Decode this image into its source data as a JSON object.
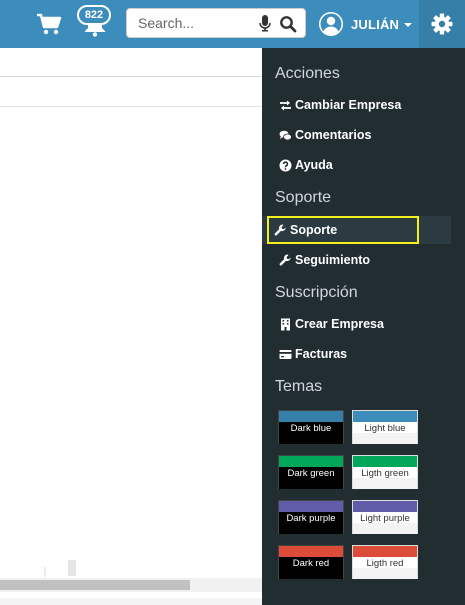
{
  "header": {
    "notifications_count": "822",
    "search_placeholder": "Search...",
    "user_name": "JULIÁN",
    "colors": {
      "bar": "#3c8dbc",
      "bar_dark": "#367fa9"
    }
  },
  "sidebar": {
    "background": "#222d32",
    "sections": {
      "acciones": "Acciones",
      "soporte": "Soporte",
      "suscripcion": "Suscripción",
      "temas": "Temas"
    },
    "items": {
      "cambiar_empresa": "Cambiar Empresa",
      "comentarios": "Comentarios",
      "ayuda": "Ayuda",
      "soporte": "Soporte",
      "seguimiento": "Seguimiento",
      "crear_empresa": "Crear Empresa",
      "facturas": "Facturas"
    },
    "themes": [
      {
        "label": "Dark blue",
        "color": "#367fa9"
      },
      {
        "label": "Light blue",
        "color": "#3c8dbc"
      },
      {
        "label": "Dark green",
        "color": "#00a65a"
      },
      {
        "label": "Ligth green",
        "color": "#00a65a"
      },
      {
        "label": "Dark purple",
        "color": "#605ca8"
      },
      {
        "label": "Light purple",
        "color": "#605ca8"
      },
      {
        "label": "Dark red",
        "color": "#dd4b39"
      },
      {
        "label": "Ligth red",
        "color": "#dd4b39"
      }
    ]
  }
}
